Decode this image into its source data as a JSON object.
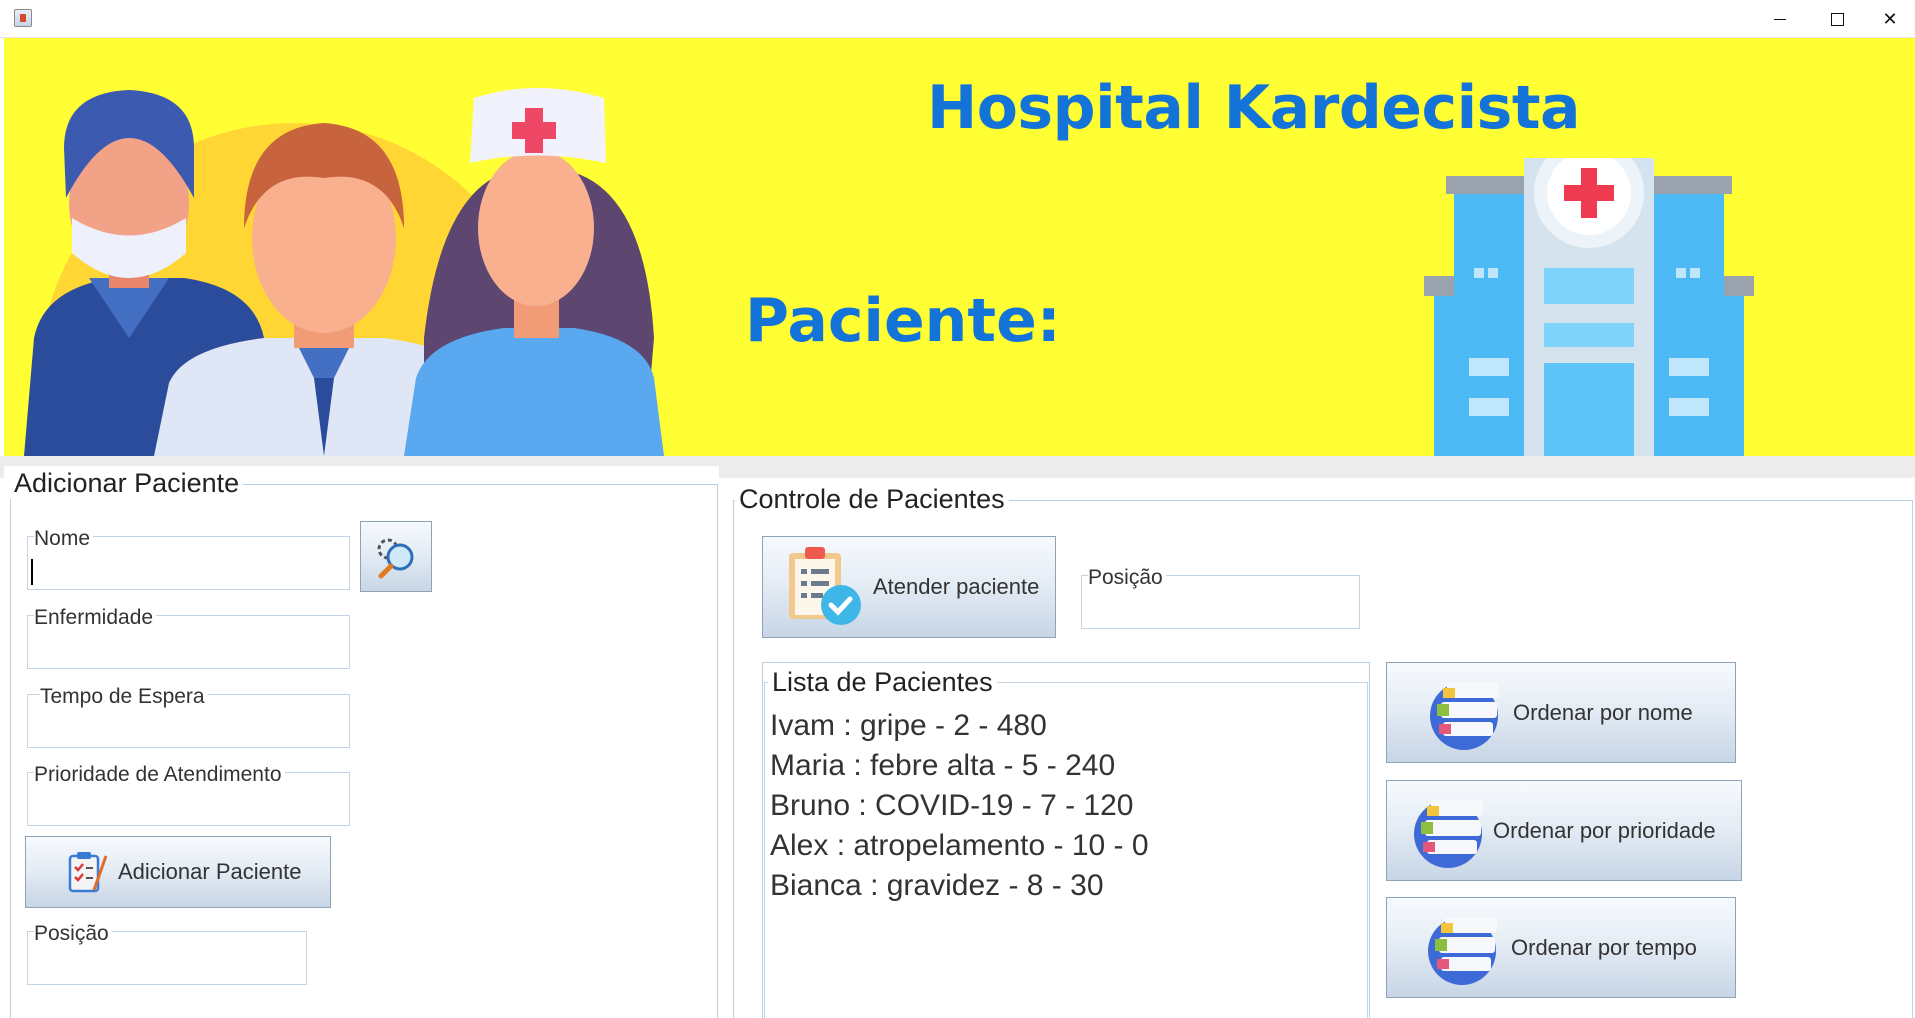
{
  "window": {
    "min_label": "",
    "max_label": "",
    "close_label": "✕"
  },
  "banner": {
    "title": "Hospital Kardecista",
    "patient_label": "Paciente:"
  },
  "add_panel": {
    "title": "Adicionar Paciente",
    "fields": {
      "name_label": "Nome",
      "name_value": "",
      "disease_label": "Enfermidade",
      "disease_value": "",
      "wait_label": "Tempo de Espera",
      "wait_value": "",
      "priority_label": "Prioridade de Atendimento",
      "priority_value": "",
      "position_label": "Posição",
      "position_value": ""
    },
    "add_button_label": "Adicionar Paciente"
  },
  "control_panel": {
    "title": "Controle de Pacientes",
    "attend_button_label": "Atender paciente",
    "position_label": "Posição",
    "position_value": "",
    "list_title": "Lista de Pacientes",
    "patients": [
      "Ivam : gripe - 2 - 480",
      "Maria : febre alta - 5 - 240",
      "Bruno : COVID-19 - 7 - 120",
      "Alex : atropelamento - 10 - 0",
      "Bianca : gravidez - 8 - 30"
    ],
    "sort_buttons": {
      "by_name": "Ordenar por nome",
      "by_priority": "Ordenar por prioridade",
      "by_time": "Ordenar por tempo"
    }
  },
  "colors": {
    "banner_bg": "#ffff33",
    "title_blue": "#1473d9",
    "border": "#b8cfe4"
  }
}
